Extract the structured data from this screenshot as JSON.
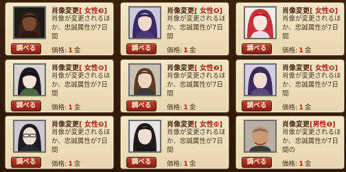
{
  "button_label": "調べる",
  "price_label": "価格:",
  "currency": "金",
  "items": [
    {
      "title": "肖像変更",
      "gender": "[ 女性❸]",
      "desc": "肖像が変更されるほか、忠誠属性が7日間",
      "price": "1",
      "portrait": "portrait-woman-dark-hair"
    },
    {
      "title": "肖像変更",
      "gender": "[ 女性❹]",
      "desc": "肖像が変更されるほか、忠誠属性が7日間",
      "price": "1",
      "portrait": "portrait-woman-purple-hair"
    },
    {
      "title": "肖像変更",
      "gender": "[ 女性❺]",
      "desc": "肖像が変更されるほか、忠誠属性が7日間",
      "price": "1",
      "portrait": "portrait-woman-red-hair"
    },
    {
      "title": "肖像変更",
      "gender": "[ 女性❻]",
      "desc": "肖像が変更されるほか、忠誠属性が7日間",
      "price": "1",
      "portrait": "portrait-woman-black-hair-braids"
    },
    {
      "title": "肖像変更",
      "gender": "[ 女性❼]",
      "desc": "肖像が変更されるほか、忠誠属性が7日間",
      "price": "1",
      "portrait": "portrait-woman-brown-hair"
    },
    {
      "title": "肖像変更",
      "gender": "[ 女性❽]",
      "desc": "肖像が変更されるほか、忠誠属性が7日間",
      "price": "1",
      "portrait": "portrait-woman-purple-hair-elf"
    },
    {
      "title": "肖像変更",
      "gender": "[ 女性❾]",
      "desc": "肖像が変更されるほか、忠誠属性が7日間",
      "price": "1",
      "portrait": "portrait-woman-glasses"
    },
    {
      "title": "肖像変更",
      "gender": "[ 女性❿]",
      "desc": "肖像が変更されるほか、忠誠属性が7日間",
      "price": "1",
      "portrait": "portrait-woman-long-dark-hair"
    },
    {
      "title": "肖像変更",
      "gender": "[男性❶]",
      "desc": "肖像が変更されるほか、忠誠属性が7日間の",
      "price": "1",
      "portrait": "portrait-man-bald"
    }
  ],
  "colors": {
    "card_bg": "#efe1bf",
    "button": "#a8301e",
    "price_red": "#d01010",
    "gender_red": "#b01a10"
  }
}
